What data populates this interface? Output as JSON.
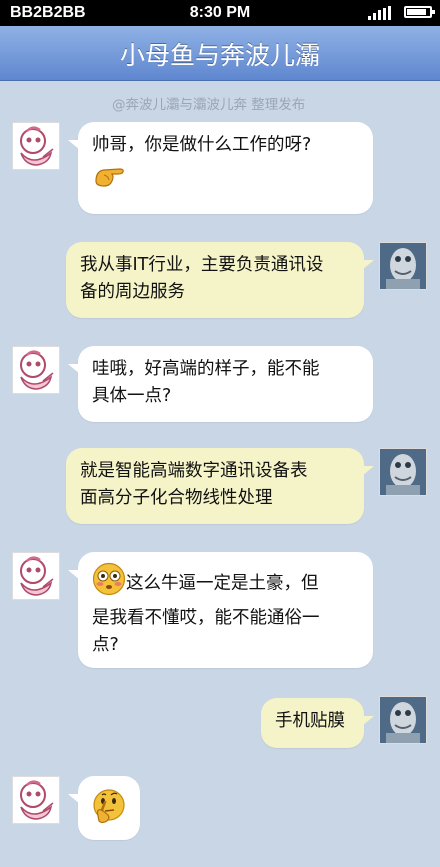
{
  "status_bar": {
    "carrier": "BB2B2BB",
    "time": "8:30 PM",
    "battery_level": 0.85
  },
  "header": {
    "title": "小母鱼与奔波儿灞"
  },
  "watermark": "@奔波儿灞与灞波儿奔 整理发布",
  "messages": [
    {
      "side": "left",
      "sender": "小母鱼",
      "lines": [
        "帅哥，你是做什么工作的呀?"
      ],
      "emoji": "pointing-hand-emoji"
    },
    {
      "side": "right",
      "sender": "奔波儿灞",
      "lines": [
        "我从事IT行业，主要负责通讯设",
        "备的周边服务"
      ]
    },
    {
      "side": "left",
      "sender": "小母鱼",
      "lines": [
        "哇哦，好高端的样子，能不能",
        "具体一点?"
      ]
    },
    {
      "side": "right",
      "sender": "奔波儿灞",
      "lines": [
        "就是智能高端数字通讯设备表",
        "面高分子化合物线性处理"
      ]
    },
    {
      "side": "left",
      "sender": "小母鱼",
      "lines": [
        "这么牛逼一定是土豪，但",
        "是我看不懂哎，能不能通俗一",
        "点?"
      ],
      "emoji": "flushed-face-emoji"
    },
    {
      "side": "right",
      "sender": "奔波儿灞",
      "lines": [
        "手机贴膜"
      ]
    },
    {
      "side": "left",
      "sender": "小母鱼",
      "lines": [],
      "emoji": "thinking-face-emoji"
    }
  ],
  "colors": {
    "chat_bg": "#c9d6e6",
    "nav_top": "#8fb1e5",
    "nav_bottom": "#5f87cf",
    "incoming": "#ffffff",
    "outgoing": "#f5f3c8"
  }
}
